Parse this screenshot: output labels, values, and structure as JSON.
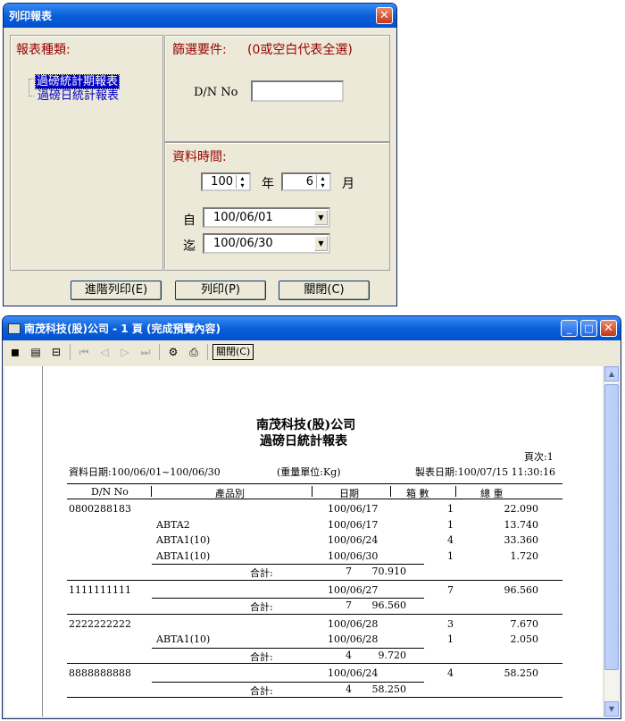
{
  "dialog": {
    "title": "列印報表",
    "report_type_label": "報表種類:",
    "report_types": [
      "過磅統計期報表",
      "過磅日統計報表"
    ],
    "filter_label": "篩選要件:",
    "filter_hint": "(0或空白代表全選)",
    "dn_label": "D/N No",
    "dn_value": "",
    "period_label": "資料時間:",
    "year_value": "100",
    "year_unit": "年",
    "month_value": "6",
    "month_unit": "月",
    "from_label": "自",
    "from_value": "100/06/01",
    "to_label": "迄",
    "to_value": "100/06/30",
    "buttons": {
      "advanced": "進階列印(E)",
      "print": "列印(P)",
      "close": "關閉(C)"
    }
  },
  "preview": {
    "title": "南茂科技(股)公司 - 1 頁 (完成預覽內容)",
    "toolbar_close": "關閉(C)",
    "report": {
      "company": "南茂科技(股)公司",
      "name": "過磅日統計報表",
      "page_label": "頁次:1",
      "date_range": "資料日期:100/06/01~100/06/30",
      "unit": "(重量單位:Kg)",
      "print_time": "製表日期:100/07/15 11:30:16",
      "headers": [
        "D/N No",
        "產品別",
        "日期",
        "箱  數",
        "總  重"
      ],
      "rows": [
        {
          "dn": "0800288183",
          "product": "",
          "date": "100/06/17",
          "boxes": "1",
          "weight": "22.090"
        },
        {
          "dn": "",
          "product": "ABTA2",
          "date": "100/06/17",
          "boxes": "1",
          "weight": "13.740"
        },
        {
          "dn": "",
          "product": "ABTA1(10)",
          "date": "100/06/24",
          "boxes": "4",
          "weight": "33.360"
        },
        {
          "dn": "",
          "product": "ABTA1(10)",
          "date": "100/06/30",
          "boxes": "1",
          "weight": "1.720"
        },
        {
          "subtotal": true,
          "label": "合計:",
          "boxes": "7",
          "weight": "70.910"
        },
        {
          "dn": "1111111111",
          "product": "",
          "date": "100/06/27",
          "boxes": "7",
          "weight": "96.560"
        },
        {
          "subtotal": true,
          "label": "合計:",
          "boxes": "7",
          "weight": "96.560"
        },
        {
          "dn": "2222222222",
          "product": "",
          "date": "100/06/28",
          "boxes": "3",
          "weight": "7.670"
        },
        {
          "dn": "",
          "product": "ABTA1(10)",
          "date": "100/06/28",
          "boxes": "1",
          "weight": "2.050"
        },
        {
          "subtotal": true,
          "label": "合計:",
          "boxes": "4",
          "weight": "9.720"
        },
        {
          "dn": "8888888888",
          "product": "",
          "date": "100/06/24",
          "boxes": "4",
          "weight": "58.250"
        },
        {
          "subtotal": true,
          "label": "合計:",
          "boxes": "4",
          "weight": "58.250"
        }
      ]
    }
  }
}
